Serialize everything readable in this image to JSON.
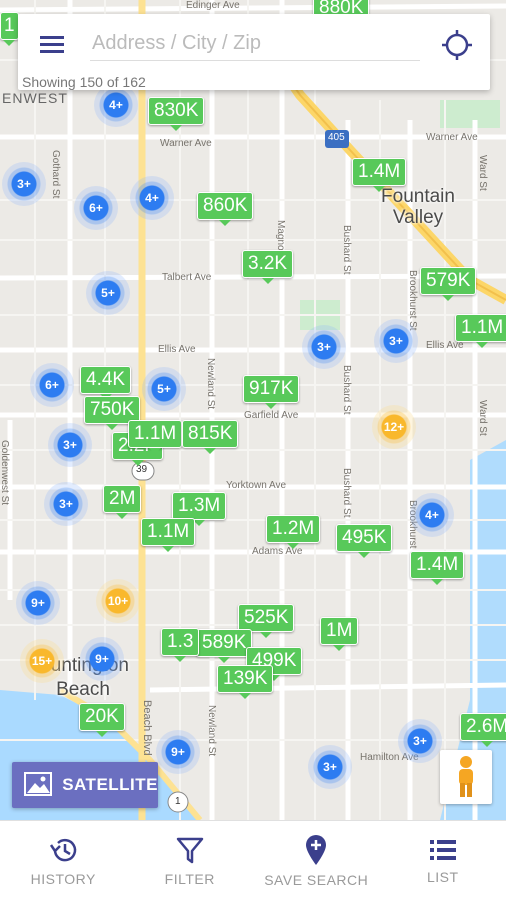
{
  "search": {
    "placeholder": "Address / City / Zip",
    "showing": "Showing 150 of 162"
  },
  "streets": {
    "edinger": "Edinger Ave",
    "warner": "Warner Ave",
    "talbert": "Talbert Ave",
    "ellis_w": "Ellis Ave",
    "ellis_e": "Ellis Ave",
    "garfield": "Garfield Ave",
    "yorktown": "Yorktown Ave",
    "adams": "Adams Ave",
    "hamilton": "Hamilton Ave",
    "gothard": "Gothard St",
    "goldenwest": "Goldenwest St",
    "newland": "Newland St",
    "magnolia": "Magnolia St",
    "bushard": "Bushard St",
    "brookhurst": "Brookhurst St",
    "ward": "Ward St",
    "beach": "Beach Blvd",
    "highway_405": "405",
    "highway_39": "39",
    "highway_1": "1",
    "fountain_valley_edge": "ENWEST"
  },
  "cities": {
    "fountain_valley": "Fountain Valley",
    "huntington_beach": "Huntington Beach"
  },
  "prices": [
    "880K",
    "830K",
    "1.4M",
    "860K",
    "3.2K",
    "579K",
    "1.1M",
    "4.4K",
    "750K",
    "2.2K",
    "1.1M",
    "815K",
    "917K",
    "2M",
    "1.3M",
    "1.1M",
    "1.2M",
    "495K",
    "1.4M",
    "525K",
    "1M",
    "589K",
    "1.3",
    "499K",
    "139K",
    "20K",
    "2.6M",
    "1"
  ],
  "clusters": [
    "4+",
    "3+",
    "6+",
    "4+",
    "5+",
    "3+",
    "3+",
    "6+",
    "5+",
    "3+",
    "12+",
    "3+",
    "4+",
    "9+",
    "10+",
    "9+",
    "15+",
    "9+",
    "3+",
    "3+"
  ],
  "colors": {
    "price_green": "#58c95a",
    "cluster_blue": "#2d7cf1",
    "cluster_yellow": "#f9b82c",
    "accent": "#3b3f8c",
    "satellite_bg": "#6b6fc0"
  },
  "buttons": {
    "satellite": "SATELLITE"
  },
  "nav": [
    {
      "label": "HISTORY",
      "icon": "history-icon"
    },
    {
      "label": "FILTER",
      "icon": "filter-icon"
    },
    {
      "label": "SAVE SEARCH",
      "icon": "map-pin-plus-icon"
    },
    {
      "label": "LIST",
      "icon": "list-icon"
    }
  ]
}
